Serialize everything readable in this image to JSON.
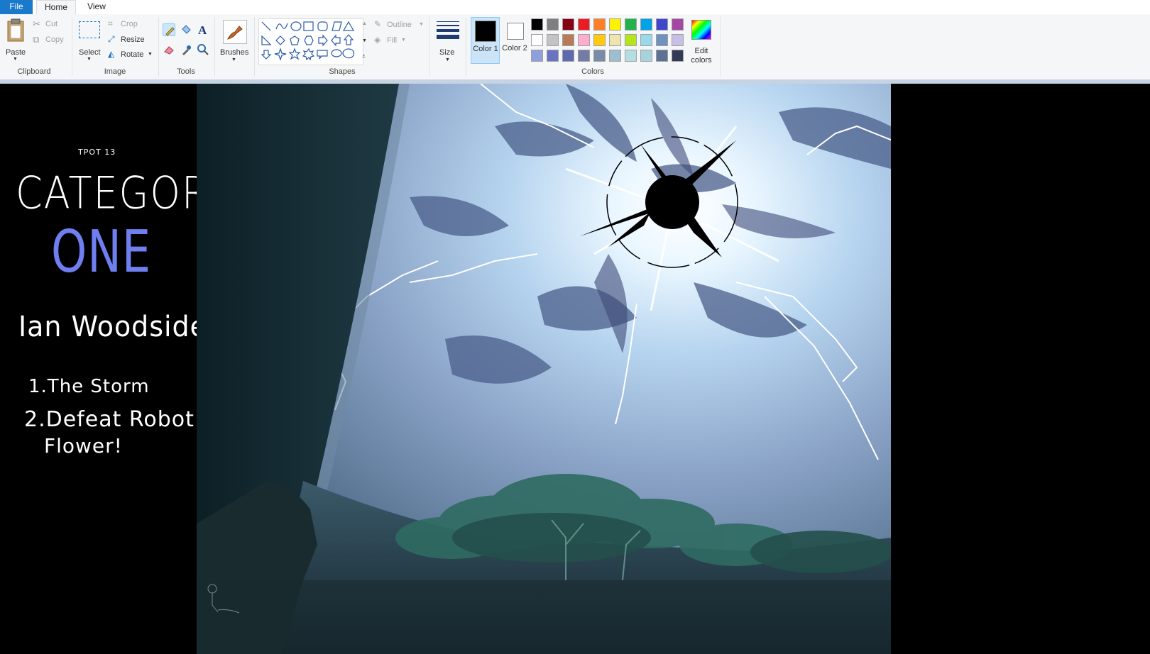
{
  "tabs": {
    "file": "File",
    "home": "Home",
    "view": "View"
  },
  "clipboard": {
    "paste": "Paste",
    "cut": "Cut",
    "copy": "Copy",
    "label": "Clipboard"
  },
  "image": {
    "select": "Select",
    "crop": "Crop",
    "resize": "Resize",
    "rotate": "Rotate",
    "label": "Image"
  },
  "tools": {
    "label": "Tools",
    "selected": "pencil"
  },
  "brushes": {
    "label": "Brushes"
  },
  "shapes": {
    "outline": "Outline",
    "fill": "Fill",
    "label": "Shapes"
  },
  "size": {
    "label": "Size"
  },
  "colors": {
    "color1_label": "Color 1",
    "color2_label": "Color 2",
    "color1": "#000000",
    "color2": "#ffffff",
    "edit_label": "Edit colors",
    "label": "Colors",
    "palette": [
      "#000000",
      "#7f7f7f",
      "#880015",
      "#ed1c24",
      "#ff7f27",
      "#fff200",
      "#22b14c",
      "#00a2e8",
      "#3f48cc",
      "#a349a4",
      "#ffffff",
      "#c3c3c3",
      "#b97a57",
      "#ffaec9",
      "#ffc90e",
      "#efe4b0",
      "#b5e61d",
      "#99d9ea",
      "#7092be",
      "#c8bfe7",
      "#8f9fdc",
      "#6a73c0",
      "#5e69b0",
      "#727ca6",
      "#7a8ba8",
      "#9dbed0",
      "#b5dde3",
      "#a8d3dc",
      "#5e7195",
      "#323a58"
    ]
  },
  "canvas": {
    "small_title": "TPOT 13",
    "category": "CATEGORY",
    "one": "ONE",
    "author": "Ian Woodside",
    "track1": "1.The Storm",
    "track2a": "2.Defeat Robot",
    "track2b": "Flower!"
  }
}
